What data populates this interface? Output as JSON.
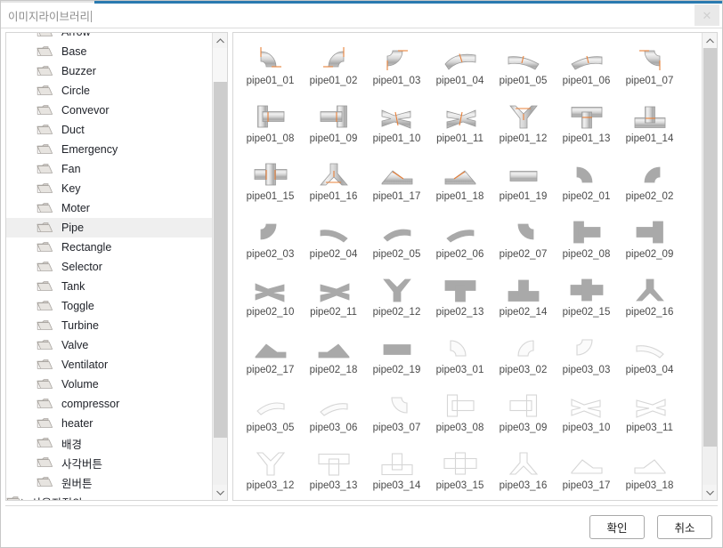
{
  "window": {
    "title": "이미지라이브러리",
    "close_label": "✕",
    "accent_color": "#2a7ab0"
  },
  "tree": {
    "items": [
      {
        "label": "Arrow",
        "icon": "folder-icon",
        "selected": false,
        "clipped": true
      },
      {
        "label": "Base",
        "icon": "folder-icon",
        "selected": false
      },
      {
        "label": "Buzzer",
        "icon": "folder-icon",
        "selected": false
      },
      {
        "label": "Circle",
        "icon": "folder-icon",
        "selected": false
      },
      {
        "label": "Convevor",
        "icon": "folder-icon",
        "selected": false
      },
      {
        "label": "Duct",
        "icon": "folder-icon",
        "selected": false
      },
      {
        "label": "Emergency",
        "icon": "folder-icon",
        "selected": false
      },
      {
        "label": "Fan",
        "icon": "folder-icon",
        "selected": false
      },
      {
        "label": "Key",
        "icon": "folder-icon",
        "selected": false
      },
      {
        "label": "Moter",
        "icon": "folder-icon",
        "selected": false
      },
      {
        "label": "Pipe",
        "icon": "folder-icon",
        "selected": true
      },
      {
        "label": "Rectangle",
        "icon": "folder-icon",
        "selected": false
      },
      {
        "label": "Selector",
        "icon": "folder-icon",
        "selected": false
      },
      {
        "label": "Tank",
        "icon": "folder-icon",
        "selected": false
      },
      {
        "label": "Toggle",
        "icon": "folder-icon",
        "selected": false
      },
      {
        "label": "Turbine",
        "icon": "folder-icon",
        "selected": false
      },
      {
        "label": "Valve",
        "icon": "folder-icon",
        "selected": false
      },
      {
        "label": "Ventilator",
        "icon": "folder-icon",
        "selected": false
      },
      {
        "label": "Volume",
        "icon": "folder-icon",
        "selected": false
      },
      {
        "label": "compressor",
        "icon": "folder-icon",
        "selected": false
      },
      {
        "label": "heater",
        "icon": "folder-icon",
        "selected": false
      },
      {
        "label": "배경",
        "icon": "folder-icon",
        "selected": false
      },
      {
        "label": "사각버튼",
        "icon": "folder-icon",
        "selected": false
      },
      {
        "label": "원버튼",
        "icon": "folder-icon",
        "selected": false
      },
      {
        "label": "사용자정의",
        "icon": "folder-icon",
        "selected": false,
        "root": true,
        "clipped": true
      }
    ],
    "scrollbar": {
      "up_arrow": "▲",
      "down_arrow": "▼"
    }
  },
  "grid": {
    "items": [
      {
        "label": "pipe01_01",
        "shape": "elbow-tr",
        "style": "lit"
      },
      {
        "label": "pipe01_02",
        "shape": "elbow-tl",
        "style": "lit"
      },
      {
        "label": "pipe01_03",
        "shape": "elbow-br",
        "style": "lit"
      },
      {
        "label": "pipe01_04",
        "shape": "bend-diag",
        "style": "lit"
      },
      {
        "label": "pipe01_05",
        "shape": "bend-diag2",
        "style": "lit"
      },
      {
        "label": "pipe01_06",
        "shape": "bend-diag3",
        "style": "lit"
      },
      {
        "label": "pipe01_07",
        "shape": "elbow-bl",
        "style": "lit"
      },
      {
        "label": "pipe01_08",
        "shape": "tee-right",
        "style": "lit"
      },
      {
        "label": "pipe01_09",
        "shape": "tee-left",
        "style": "lit"
      },
      {
        "label": "pipe01_10",
        "shape": "y-right",
        "style": "lit"
      },
      {
        "label": "pipe01_11",
        "shape": "y-left",
        "style": "lit"
      },
      {
        "label": "pipe01_12",
        "shape": "y-up",
        "style": "lit"
      },
      {
        "label": "pipe01_13",
        "shape": "tee-down",
        "style": "lit"
      },
      {
        "label": "pipe01_14",
        "shape": "tee-up",
        "style": "lit"
      },
      {
        "label": "pipe01_15",
        "shape": "cross",
        "style": "lit"
      },
      {
        "label": "pipe01_16",
        "shape": "y-down",
        "style": "lit"
      },
      {
        "label": "pipe01_17",
        "shape": "ramp-right",
        "style": "lit"
      },
      {
        "label": "pipe01_18",
        "shape": "ramp-left",
        "style": "lit"
      },
      {
        "label": "pipe01_19",
        "shape": "straight",
        "style": "lit"
      },
      {
        "label": "pipe02_01",
        "shape": "arc-tr",
        "style": "flat"
      },
      {
        "label": "pipe02_02",
        "shape": "arc-tl",
        "style": "flat"
      },
      {
        "label": "pipe02_03",
        "shape": "arc-br",
        "style": "flat"
      },
      {
        "label": "pipe02_04",
        "shape": "arc-sm1",
        "style": "flat"
      },
      {
        "label": "pipe02_05",
        "shape": "arc-sm2",
        "style": "flat"
      },
      {
        "label": "pipe02_06",
        "shape": "arc-sm3",
        "style": "flat"
      },
      {
        "label": "pipe02_07",
        "shape": "arc-bl",
        "style": "flat"
      },
      {
        "label": "pipe02_08",
        "shape": "tee-right",
        "style": "flat"
      },
      {
        "label": "pipe02_09",
        "shape": "tee-left",
        "style": "flat"
      },
      {
        "label": "pipe02_10",
        "shape": "y-right",
        "style": "flat"
      },
      {
        "label": "pipe02_11",
        "shape": "y-left",
        "style": "flat"
      },
      {
        "label": "pipe02_12",
        "shape": "y-up",
        "style": "flat"
      },
      {
        "label": "pipe02_13",
        "shape": "tee-down",
        "style": "flat"
      },
      {
        "label": "pipe02_14",
        "shape": "tee-up",
        "style": "flat"
      },
      {
        "label": "pipe02_15",
        "shape": "cross",
        "style": "flat"
      },
      {
        "label": "pipe02_16",
        "shape": "y-down",
        "style": "flat"
      },
      {
        "label": "pipe02_17",
        "shape": "ramp-right",
        "style": "flat"
      },
      {
        "label": "pipe02_18",
        "shape": "ramp-left",
        "style": "flat"
      },
      {
        "label": "pipe02_19",
        "shape": "straight",
        "style": "flat"
      },
      {
        "label": "pipe03_01",
        "shape": "arc-tr",
        "style": "outline"
      },
      {
        "label": "pipe03_02",
        "shape": "arc-tl",
        "style": "outline"
      },
      {
        "label": "pipe03_03",
        "shape": "arc-br",
        "style": "outline"
      },
      {
        "label": "pipe03_04",
        "shape": "arc-sm1",
        "style": "outline"
      },
      {
        "label": "pipe03_05",
        "shape": "arc-sm2",
        "style": "outline"
      },
      {
        "label": "pipe03_06",
        "shape": "arc-sm3",
        "style": "outline"
      },
      {
        "label": "pipe03_07",
        "shape": "arc-bl",
        "style": "outline"
      },
      {
        "label": "pipe03_08",
        "shape": "tee-right",
        "style": "outline"
      },
      {
        "label": "pipe03_09",
        "shape": "tee-left",
        "style": "outline"
      },
      {
        "label": "pipe03_10",
        "shape": "y-right",
        "style": "outline"
      },
      {
        "label": "pipe03_11",
        "shape": "y-left",
        "style": "outline"
      },
      {
        "label": "pipe03_12",
        "shape": "y-up",
        "style": "outline"
      },
      {
        "label": "pipe03_13",
        "shape": "tee-down",
        "style": "outline"
      },
      {
        "label": "pipe03_14",
        "shape": "tee-up",
        "style": "outline"
      },
      {
        "label": "pipe03_15",
        "shape": "cross",
        "style": "outline"
      },
      {
        "label": "pipe03_16",
        "shape": "y-down",
        "style": "outline"
      },
      {
        "label": "pipe03_17",
        "shape": "ramp-right",
        "style": "outline"
      },
      {
        "label": "pipe03_18",
        "shape": "ramp-left",
        "style": "outline"
      }
    ],
    "columns": 7
  },
  "footer": {
    "ok_label": "확인",
    "cancel_label": "취소"
  }
}
